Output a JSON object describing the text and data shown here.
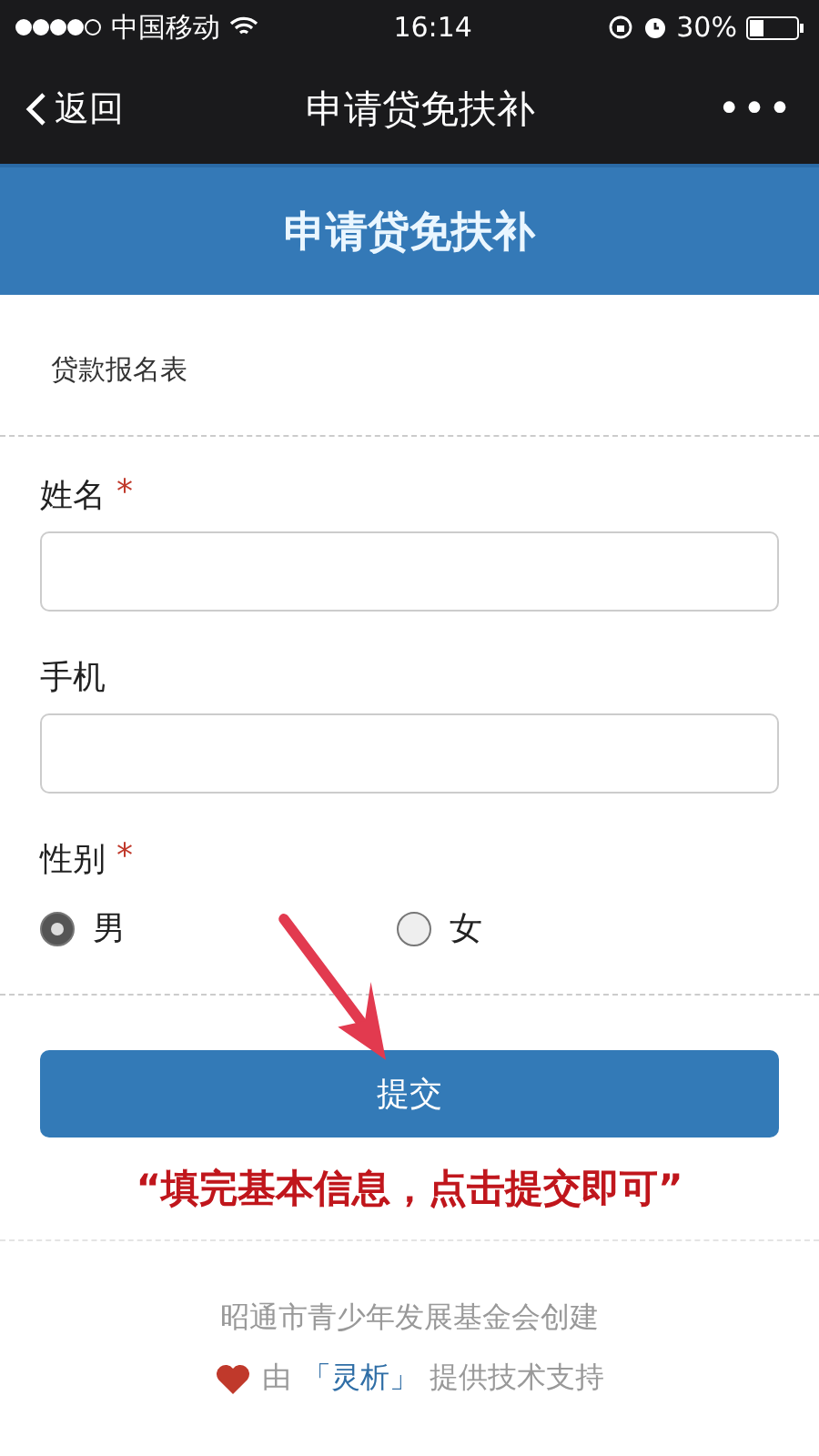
{
  "status_bar": {
    "carrier": "中国移动",
    "time": "16:14",
    "battery": "30%"
  },
  "nav_bar": {
    "back": "返回",
    "title": "申请贷免扶补",
    "more": "•••"
  },
  "header": {
    "title": "申请贷免扶补"
  },
  "form": {
    "section_title": "贷款报名表",
    "fields": [
      {
        "kind": "text",
        "label": "姓名",
        "required_mark": "*"
      },
      {
        "kind": "text",
        "label": "手机"
      },
      {
        "kind": "radio",
        "label": "性别",
        "required_mark": "*",
        "options": [
          {
            "label": "男",
            "selected": true
          },
          {
            "label": "女",
            "selected": false
          }
        ]
      }
    ],
    "submit": "提交"
  },
  "annotation": {
    "caption": "“填完基本信息，点击提交即可”"
  },
  "footer": {
    "creator": "昭通市青少年发展基金会创建",
    "powered_prefix": "由",
    "powered_brand": "「灵析」",
    "powered_suffix": "提供技术支持"
  }
}
